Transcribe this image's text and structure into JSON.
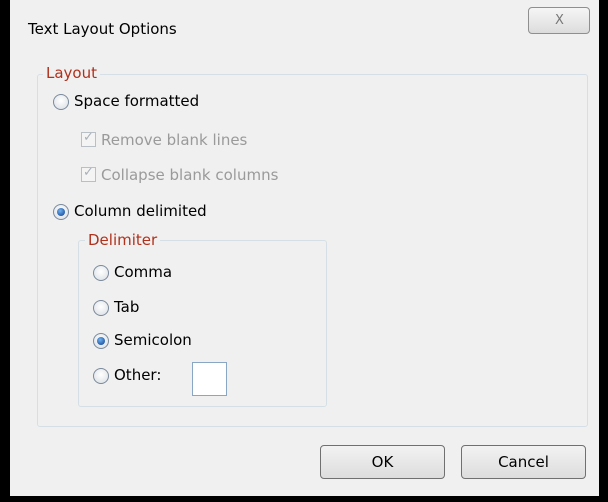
{
  "window": {
    "title": "Text Layout Options",
    "close_glyph": "X"
  },
  "layout_group": {
    "legend": "Layout",
    "space_formatted": {
      "label": "Space formatted",
      "selected": false
    },
    "remove_blank_lines": {
      "label": "Remove blank lines",
      "checked": true,
      "enabled": false
    },
    "collapse_blank_columns": {
      "label": "Collapse blank columns",
      "checked": true,
      "enabled": false
    },
    "column_delimited": {
      "label": "Column delimited",
      "selected": true
    }
  },
  "delimiter_group": {
    "legend": "Delimiter",
    "options": [
      {
        "label": "Comma",
        "selected": false
      },
      {
        "label": "Tab",
        "selected": false
      },
      {
        "label": "Semicolon",
        "selected": true
      },
      {
        "label": "Other:",
        "selected": false
      }
    ],
    "other_value": ""
  },
  "buttons": {
    "ok": "OK",
    "cancel": "Cancel"
  },
  "icons": {
    "close": "close-icon",
    "check": "check-icon"
  },
  "colors": {
    "legend_text": "#b0311c",
    "dialog_bg": "#f0f0f0"
  }
}
